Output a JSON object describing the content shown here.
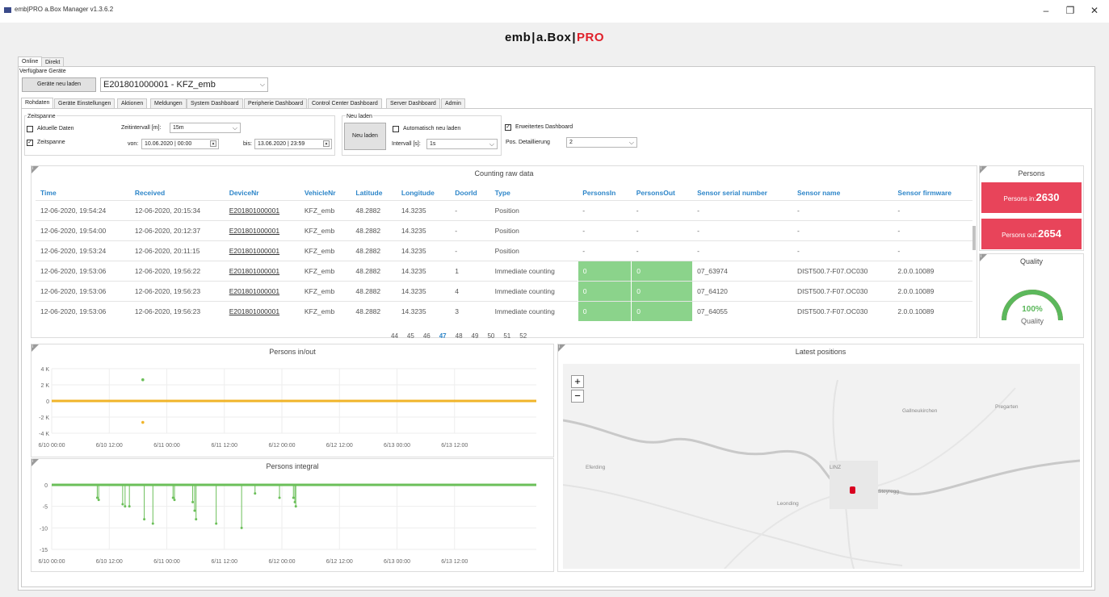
{
  "window": {
    "title": "emb|PRO a.Box Manager v1.3.6.2",
    "controls": {
      "minimize": "–",
      "maximize": "❐",
      "close": "✕"
    }
  },
  "logo": {
    "part1": "emb",
    "sep1": "|",
    "part2": "a.Box",
    "sep2": "|",
    "part3": "PRO"
  },
  "top_tabs": [
    "Online",
    "Direkt"
  ],
  "devices": {
    "section_label": "Verfügbare Geräte",
    "reload_button": "Geräte neu laden",
    "selected": "E201801000001 - KFZ_emb"
  },
  "sub_tabs": [
    "Rohdaten",
    "Geräte Einstellungen",
    "Aktionen",
    "Meldungen",
    "System Dashboard",
    "Peripherie Dashboard",
    "Control Center Dashboard",
    "Server Dashboard",
    "Admin"
  ],
  "zeitspanne": {
    "label": "Zeitspanne",
    "aktuelle_daten": "Aktuelle Daten",
    "zeitspanne_check": "Zeitspanne",
    "zeitintervall_label": "Zeitintervall [m]:",
    "zeitintervall_value": "15m",
    "von_label": "von:",
    "von_value": "10.06.2020 | 00:00",
    "bis_label": "bis:",
    "bis_value": "13.06.2020 | 23:59"
  },
  "neu_laden": {
    "label": "Neu laden",
    "button": "Neu laden",
    "auto_label": "Automatisch neu laden",
    "intervall_label": "Intervall [s]:",
    "intervall_value": "1s"
  },
  "dashboard_opts": {
    "erweitert_label": "Erweitertes Dashboard",
    "pos_label": "Pos. Detaillierung",
    "pos_value": "2"
  },
  "raw_table": {
    "title": "Counting raw data",
    "columns": [
      "Time",
      "Received",
      "DeviceNr",
      "VehicleNr",
      "Latitude",
      "Longitude",
      "DoorId",
      "Type",
      "PersonsIn",
      "PersonsOut",
      "Sensor serial number",
      "Sensor name",
      "Sensor firmware"
    ],
    "rows": [
      [
        "12-06-2020, 19:54:24",
        "12-06-2020, 20:15:34",
        "E201801000001",
        "KFZ_emb",
        "48.2882",
        "14.3235",
        "-",
        "Position",
        "-",
        "-",
        "-",
        "-",
        "-"
      ],
      [
        "12-06-2020, 19:54:00",
        "12-06-2020, 20:12:37",
        "E201801000001",
        "KFZ_emb",
        "48.2882",
        "14.3235",
        "-",
        "Position",
        "-",
        "-",
        "-",
        "-",
        "-"
      ],
      [
        "12-06-2020, 19:53:24",
        "12-06-2020, 20:11:15",
        "E201801000001",
        "KFZ_emb",
        "48.2882",
        "14.3235",
        "-",
        "Position",
        "-",
        "-",
        "-",
        "-",
        "-"
      ],
      [
        "12-06-2020, 19:53:06",
        "12-06-2020, 19:56:22",
        "E201801000001",
        "KFZ_emb",
        "48.2882",
        "14.3235",
        "1",
        "Immediate counting",
        "0",
        "0",
        "07_63974",
        "DIST500.7-F07.OC030",
        "2.0.0.10089"
      ],
      [
        "12-06-2020, 19:53:06",
        "12-06-2020, 19:56:23",
        "E201801000001",
        "KFZ_emb",
        "48.2882",
        "14.3235",
        "4",
        "Immediate counting",
        "0",
        "0",
        "07_64120",
        "DIST500.7-F07.OC030",
        "2.0.0.10089"
      ],
      [
        "12-06-2020, 19:53:06",
        "12-06-2020, 19:56:23",
        "E201801000001",
        "KFZ_emb",
        "48.2882",
        "14.3235",
        "3",
        "Immediate counting",
        "0",
        "0",
        "07_64055",
        "DIST500.7-F07.OC030",
        "2.0.0.10089"
      ]
    ],
    "pages": [
      "44",
      "45",
      "46",
      "47",
      "48",
      "49",
      "50",
      "51",
      "52"
    ],
    "current_page": "47"
  },
  "persons": {
    "title": "Persons",
    "in_label": "Persons in:",
    "in_value": "2630",
    "out_label": "Persons out:",
    "out_value": "2654"
  },
  "quality": {
    "title": "Quality",
    "value_text": "100%",
    "value": 100,
    "caption": "Quality"
  },
  "info_glyph": "i",
  "persons_inout_chart": {
    "title": "Persons in/out",
    "y_ticks": [
      "4 K",
      "2 K",
      "0",
      "-2 K",
      "-4 K"
    ],
    "x_ticks": [
      "6/10 00:00",
      "6/10 12:00",
      "6/11 00:00",
      "6/11 12:00",
      "6/12 00:00",
      "6/12 12:00",
      "6/13 00:00",
      "6/13 12:00"
    ],
    "colors": {
      "in": "#6bbf59",
      "out": "#f0b429"
    }
  },
  "chart_data": [
    {
      "type": "scatter",
      "title": "Persons in/out",
      "x_ticks": [
        "6/10 00:00",
        "6/10 12:00",
        "6/11 00:00",
        "6/11 12:00",
        "6/12 00:00",
        "6/12 12:00",
        "6/13 00:00",
        "6/13 12:00"
      ],
      "ylim": [
        -4000,
        4000
      ],
      "series": [
        {
          "color": "#6bbf59",
          "points": [
            {
              "x": 19,
              "y": 2630
            }
          ]
        },
        {
          "color": "#f0b429",
          "points": [
            {
              "x": 19,
              "y": -2654
            }
          ]
        }
      ],
      "baseline": 0
    },
    {
      "type": "line",
      "title": "Persons integral",
      "x_ticks": [
        "6/10 00:00",
        "6/10 12:00",
        "6/11 00:00",
        "6/11 12:00",
        "6/12 00:00",
        "6/12 12:00",
        "6/13 00:00",
        "6/13 12:00"
      ],
      "y_ticks": [
        "0",
        "-5",
        "-10",
        "-15"
      ],
      "ylim": [
        -15,
        0
      ],
      "color": "#6bbf59",
      "drops": [
        {
          "x": 9.5,
          "y": -3
        },
        {
          "x": 9.8,
          "y": -3.5
        },
        {
          "x": 14.8,
          "y": -4.5
        },
        {
          "x": 15.3,
          "y": -5
        },
        {
          "x": 16.2,
          "y": -5
        },
        {
          "x": 19.3,
          "y": -8
        },
        {
          "x": 21.1,
          "y": -9
        },
        {
          "x": 25.3,
          "y": -3
        },
        {
          "x": 25.6,
          "y": -3.5
        },
        {
          "x": 29.4,
          "y": -4
        },
        {
          "x": 29.8,
          "y": -6
        },
        {
          "x": 30.1,
          "y": -8
        },
        {
          "x": 34.3,
          "y": -9
        },
        {
          "x": 39.6,
          "y": -10
        },
        {
          "x": 42.4,
          "y": -2
        },
        {
          "x": 47.5,
          "y": -3
        },
        {
          "x": 50.4,
          "y": -3
        },
        {
          "x": 50.7,
          "y": -4
        },
        {
          "x": 50.9,
          "y": -5
        }
      ],
      "xlim": [
        0,
        96
      ]
    }
  ],
  "integral_chart": {
    "title": "Persons integral",
    "y_ticks": [
      "0",
      "-5",
      "-10",
      "-15"
    ],
    "x_ticks": [
      "6/10 00:00",
      "6/10 12:00",
      "6/11 00:00",
      "6/11 12:00",
      "6/12 00:00",
      "6/12 12:00",
      "6/13 00:00",
      "6/13 12:00"
    ]
  },
  "map": {
    "title": "Latest positions",
    "zoom_in": "+",
    "zoom_out": "−",
    "places": [
      "Gallneukirchen",
      "Pregarten",
      "Eferding",
      "LINZ",
      "Steyregg",
      "Leonding"
    ]
  }
}
